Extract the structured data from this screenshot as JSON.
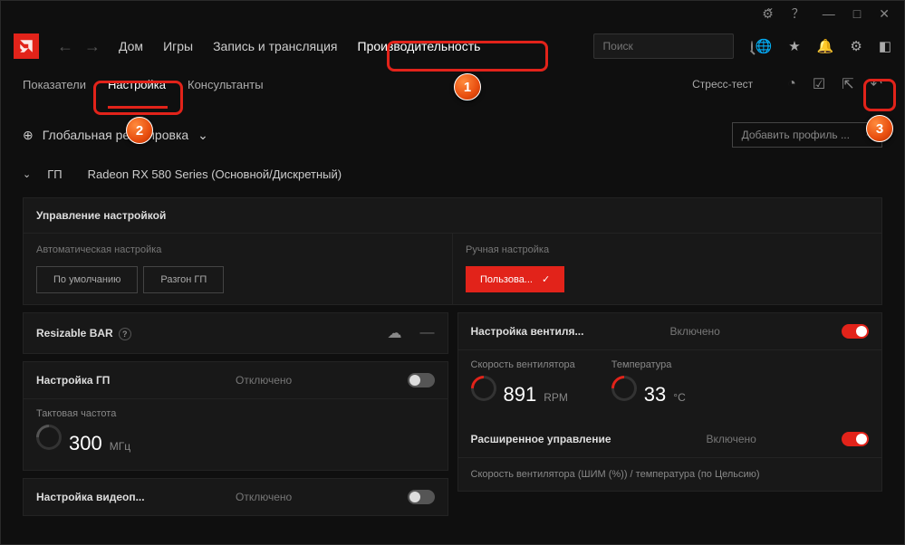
{
  "titlebar": {
    "icons": [
      "bug",
      "help",
      "min",
      "max",
      "close"
    ]
  },
  "nav": {
    "items": [
      "Дом",
      "Игры",
      "Запись и трансляция",
      "Производительность"
    ],
    "search_placeholder": "Поиск"
  },
  "subtabs": {
    "items": [
      "Показатели",
      "Настройка",
      "Консультанты"
    ],
    "stress": "Стресс-тест"
  },
  "global": {
    "label": "Глобальная регулировка",
    "add_profile": "Добавить профиль ...",
    "plus": "+"
  },
  "gpu": {
    "short": "ГП",
    "name": "Radeon RX 580 Series (Основной/Дискретный)"
  },
  "tuning": {
    "header": "Управление настройкой",
    "auto_label": "Автоматическая настройка",
    "auto_default": "По умолчанию",
    "auto_oc": "Разгон ГП",
    "manual_label": "Ручная настройка",
    "manual_custom": "Пользова..."
  },
  "rebar": {
    "label": "Resizable BAR",
    "dash": "—"
  },
  "gputune": {
    "label": "Настройка ГП",
    "state": "Отключено",
    "clock_label": "Тактовая частота",
    "clock_val": "300",
    "clock_unit": "МГц"
  },
  "video": {
    "label": "Настройка видеоп...",
    "state": "Отключено"
  },
  "fan": {
    "label": "Настройка вентиля...",
    "state": "Включено",
    "speed_label": "Скорость вентилятора",
    "speed_val": "891",
    "speed_unit": "RPM",
    "temp_label": "Температура",
    "temp_val": "33",
    "temp_unit": "°C",
    "adv_label": "Расширенное управление",
    "adv_state": "Включено",
    "pwm_label": "Скорость вентилятора (ШИМ (%)) / температура (по Цельсию)"
  }
}
